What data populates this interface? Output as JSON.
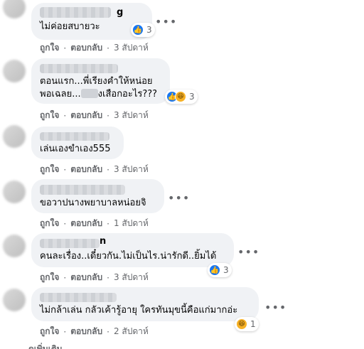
{
  "comments": [
    {
      "author_suffix": "g",
      "text": "ไม่ค่อยสบายวะ",
      "reactions": {
        "types": [
          "like"
        ],
        "count": "3"
      },
      "actions": {
        "like": "ถูกใจ",
        "reply": "ตอบกลับ",
        "time": "3 สัปดาห์"
      }
    },
    {
      "lines": [
        "ตอนแรก...พี่เรียงคำให้หน่อย",
        "พอเฉลย...",
        "งเสือกอะไร???"
      ],
      "reactions": {
        "types": [
          "like",
          "haha"
        ],
        "count": "3"
      },
      "actions": {
        "like": "ถูกใจ",
        "reply": "ตอบกลับ",
        "time": "3 สัปดาห์"
      }
    },
    {
      "text": "เล่นเองขำเอง555",
      "actions": {
        "like": "ถูกใจ",
        "reply": "ตอบกลับ",
        "time": "3 สัปดาห์"
      }
    },
    {
      "text": "ขอวาปนางพยาบาลหน่อยจิ",
      "actions": {
        "like": "ถูกใจ",
        "reply": "ตอบกลับ",
        "time": "1 สัปดาห์"
      }
    },
    {
      "author_suffix": "n",
      "text": "คนละเรื่อง..เดี๋ยวกัน.ไม่เป็นไร.น่ารักดี..ยิ้มได้",
      "reactions": {
        "types": [
          "like"
        ],
        "count": "3"
      },
      "actions": {
        "like": "ถูกใจ",
        "reply": "ตอบกลับ",
        "time": "3 สัปดาห์"
      }
    },
    {
      "text": "ไม่กล้าเล่น กลัวเค้ารู้อายุ ใครทันมุขนี้คือแก่มากอ่ะ",
      "reactions": {
        "types": [
          "haha"
        ],
        "count": "1"
      },
      "actions": {
        "like": "ถูกใจ",
        "reply": "ตอบกลับ",
        "time": "2 สัปดาห์"
      }
    }
  ],
  "more_label": "•••",
  "bottom_cut_text": "ดูเพิ่มเติม",
  "colors": {
    "bubble": "#f0f2f5",
    "meta": "#65676b",
    "like": "#1877f2",
    "haha": "#f7b125"
  }
}
